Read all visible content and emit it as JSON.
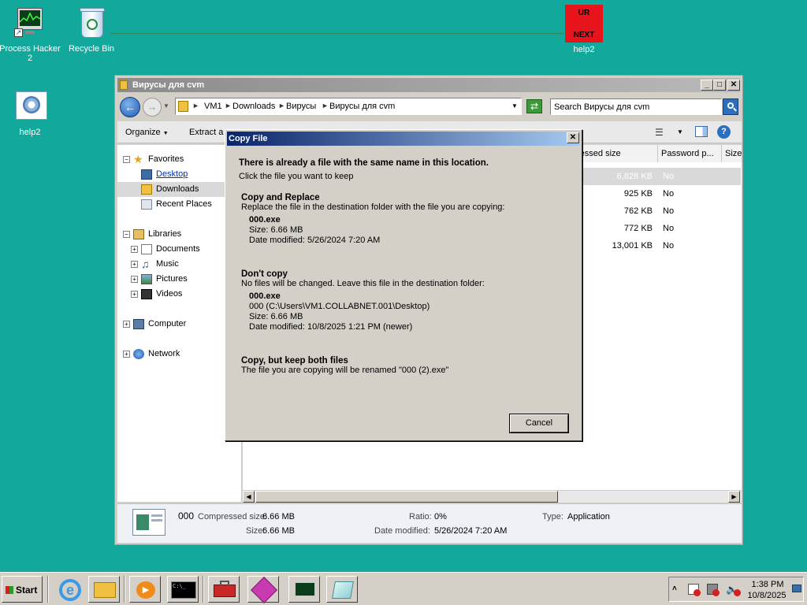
{
  "desktop": {
    "icons": [
      {
        "label": "Process Hacker 2"
      },
      {
        "label": "Recycle Bin"
      },
      {
        "label": "help2",
        "badge_top": "UR",
        "badge_bottom": "NEXT"
      },
      {
        "label": "help2"
      }
    ]
  },
  "explorer": {
    "title": "Вирусы для cvm",
    "breadcrumb": [
      "VM1",
      "Downloads",
      "Вирусы",
      "Вирусы для cvm"
    ],
    "search_placeholder": "Search Вирусы для cvm",
    "toolbar": {
      "organize": "Organize",
      "extract": "Extract a"
    },
    "nav": {
      "favorites": "Favorites",
      "desktop": "Desktop",
      "downloads": "Downloads",
      "recent": "Recent Places",
      "libraries": "Libraries",
      "documents": "Documents",
      "music": "Music",
      "pictures": "Pictures",
      "videos": "Videos",
      "computer": "Computer",
      "network": "Network"
    },
    "columns": [
      "ressed size",
      "Password p...",
      "Size"
    ],
    "rows": [
      {
        "size": "6,828 KB",
        "pw": "No"
      },
      {
        "size": "925 KB",
        "pw": "No"
      },
      {
        "size": "762 KB",
        "pw": "No"
      },
      {
        "size": "772 KB",
        "pw": "No"
      },
      {
        "size": "13,001 KB",
        "pw": "No"
      }
    ],
    "details": {
      "name": "000",
      "compressed_label": "Compressed size:",
      "compressed_value": "6.66 MB",
      "size_label": "Size:",
      "size_value": "6.66 MB",
      "ratio_label": "Ratio:",
      "ratio_value": "0%",
      "modified_label": "Date modified:",
      "modified_value": "5/26/2024 7:20 AM",
      "type_label": "Type:",
      "type_value": "Application"
    }
  },
  "dialog": {
    "title": "Copy File",
    "heading": "There is already a file with the same name in this location.",
    "subheading": "Click the file you want to keep",
    "replace": {
      "title": "Copy and Replace",
      "desc": "Replace the file in the destination folder with the file you are copying:",
      "file": "000.exe",
      "size": "Size: 6.66 MB",
      "modified": "Date modified: 5/26/2024 7:20 AM"
    },
    "dontcopy": {
      "title": "Don't copy",
      "desc": "No files will be changed. Leave this file in the destination folder:",
      "file": "000.exe",
      "path": "000 (C:\\Users\\VM1.COLLABNET.001\\Desktop)",
      "size": "Size: 6.66 MB",
      "modified": "Date modified: 10/8/2025 1:21 PM (newer)"
    },
    "keepboth": {
      "title": "Copy, but keep both files",
      "desc": "The file you are copying will be renamed \"000 (2).exe\""
    },
    "cancel": "Cancel"
  },
  "taskbar": {
    "start": "Start",
    "time": "1:38 PM",
    "date": "10/8/2025"
  }
}
